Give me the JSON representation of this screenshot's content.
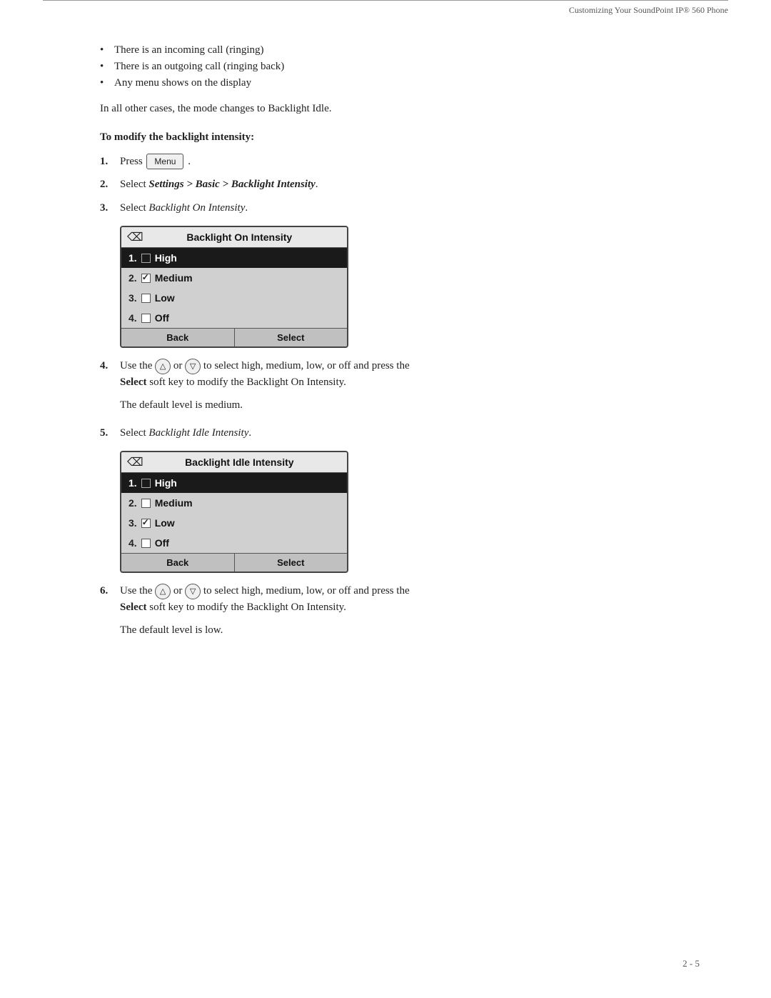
{
  "header": {
    "title": "Customizing Your SoundPoint IP® 560 Phone"
  },
  "bullets": [
    "There is an incoming call (ringing)",
    "There is an outgoing call (ringing back)",
    "Any menu shows on the display"
  ],
  "intro_para": "In all other cases, the mode changes to Backlight Idle.",
  "section_heading": "To modify the backlight intensity:",
  "steps": [
    {
      "number": "1.",
      "text_parts": [
        "Press ",
        "Menu",
        " ."
      ]
    },
    {
      "number": "2.",
      "text_parts": [
        "Select ",
        "Settings > Basic > Backlight Intensity",
        "."
      ]
    },
    {
      "number": "3.",
      "text_parts": [
        "Select ",
        "Backlight On Intensity",
        "."
      ]
    }
  ],
  "screen1": {
    "title": "Backlight On Intensity",
    "items": [
      {
        "number": "1.",
        "checkbox": "empty",
        "label": "High",
        "selected": true
      },
      {
        "number": "2.",
        "checkbox": "checked",
        "label": "Medium",
        "selected": false
      },
      {
        "number": "3.",
        "checkbox": "empty",
        "label": "Low",
        "selected": false
      },
      {
        "number": "4.",
        "checkbox": "empty",
        "label": "Off",
        "selected": false
      }
    ],
    "back_label": "Back",
    "select_label": "Select"
  },
  "step4": {
    "number": "4.",
    "text_before": "Use the ",
    "text_middle": " or ",
    "text_after": " to select high, medium, low, or off and press the",
    "bold_text": "Select",
    "sub_text": "soft key to modify the Backlight On Intensity."
  },
  "note1": "The default level is medium.",
  "step5": {
    "number": "5.",
    "text_parts": [
      "Select ",
      "Backlight Idle Intensity",
      "."
    ]
  },
  "screen2": {
    "title": "Backlight Idle Intensity",
    "items": [
      {
        "number": "1.",
        "checkbox": "empty",
        "label": "High",
        "selected": true
      },
      {
        "number": "2.",
        "checkbox": "empty",
        "label": "Medium",
        "selected": false
      },
      {
        "number": "3.",
        "checkbox": "checked",
        "label": "Low",
        "selected": false
      },
      {
        "number": "4.",
        "checkbox": "empty",
        "label": "Off",
        "selected": false
      }
    ],
    "back_label": "Back",
    "select_label": "Select"
  },
  "step6": {
    "number": "6.",
    "text_before": "Use the ",
    "text_middle": " or ",
    "text_after": " to select high, medium, low, or off and press the",
    "bold_text": "Select",
    "sub_text": "soft key to modify the Backlight On Intensity."
  },
  "note2": "The default level is low.",
  "page_number": "2 - 5"
}
